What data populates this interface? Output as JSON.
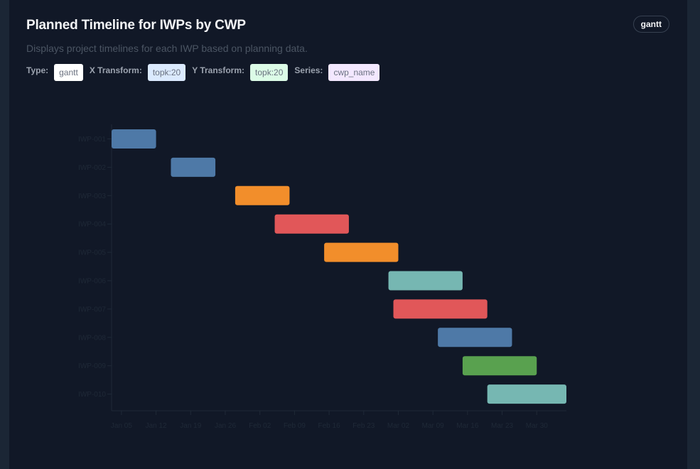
{
  "header": {
    "title": "Planned Timeline for IWPs by CWP",
    "subtitle": "Displays project timelines for each IWP based on planning data.",
    "type_badge": "gantt"
  },
  "meta": {
    "type_label": "Type:",
    "type_value": "gantt",
    "x_label": "X Transform:",
    "x_value": "topk:20",
    "y_label": "Y Transform:",
    "y_value": "topk:20",
    "series_label": "Series:",
    "series_value": "cwp_name"
  },
  "colors": {
    "blue": "#4e79a7",
    "orange": "#f28e2b",
    "red": "#e15759",
    "teal": "#76b7b2",
    "green": "#59a14f"
  },
  "chart_data": {
    "type": "gantt",
    "title": "",
    "xlabel": "",
    "ylabel": "",
    "x_ticks": [
      "Jan 05",
      "Jan 12",
      "Jan 19",
      "Jan 26",
      "Feb 02",
      "Feb 09",
      "Feb 16",
      "Feb 23",
      "Mar 02",
      "Mar 09",
      "Mar 16",
      "Mar 23",
      "Mar 30"
    ],
    "tasks": [
      {
        "name": "IWP-001",
        "start": "2025-01-03",
        "end": "2025-01-12",
        "color": "blue"
      },
      {
        "name": "IWP-002",
        "start": "2025-01-15",
        "end": "2025-01-24",
        "color": "blue"
      },
      {
        "name": "IWP-003",
        "start": "2025-01-28",
        "end": "2025-02-08",
        "color": "orange"
      },
      {
        "name": "IWP-004",
        "start": "2025-02-05",
        "end": "2025-02-20",
        "color": "red"
      },
      {
        "name": "IWP-005",
        "start": "2025-02-15",
        "end": "2025-03-02",
        "color": "orange"
      },
      {
        "name": "IWP-006",
        "start": "2025-02-28",
        "end": "2025-03-15",
        "color": "teal"
      },
      {
        "name": "IWP-007",
        "start": "2025-03-01",
        "end": "2025-03-20",
        "color": "red"
      },
      {
        "name": "IWP-008",
        "start": "2025-03-10",
        "end": "2025-03-25",
        "color": "blue"
      },
      {
        "name": "IWP-009",
        "start": "2025-03-15",
        "end": "2025-03-30",
        "color": "green"
      },
      {
        "name": "IWP-010",
        "start": "2025-03-20",
        "end": "2025-04-05",
        "color": "teal"
      }
    ]
  }
}
